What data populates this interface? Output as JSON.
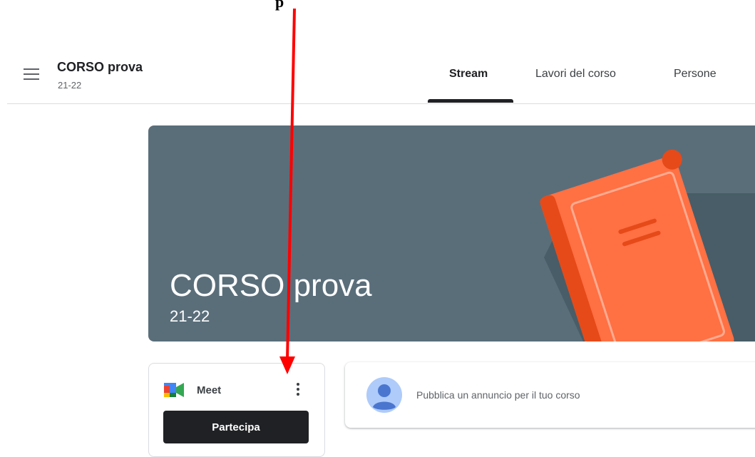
{
  "caption": "p",
  "header": {
    "menu_icon": "hamburger-menu-icon",
    "course_title": "CORSO prova",
    "course_subtitle": "21-22",
    "tabs": [
      {
        "label": "Stream",
        "active": true
      },
      {
        "label": "Lavori del corso",
        "active": false
      },
      {
        "label": "Persone",
        "active": false
      }
    ]
  },
  "banner": {
    "title": "CORSO prova",
    "subtitle": "21-22",
    "background_color": "#5a6e7a",
    "illustration": "book-icon"
  },
  "meet": {
    "label": "Meet",
    "join_label": "Partecipa",
    "icon": "google-meet-icon",
    "more_icon": "more-vertical-icon"
  },
  "announcement": {
    "placeholder": "Pubblica un annuncio per il tuo corso",
    "avatar_icon": "user-avatar-icon"
  },
  "annotation": {
    "color": "#ff0000",
    "icon": "red-arrow"
  }
}
